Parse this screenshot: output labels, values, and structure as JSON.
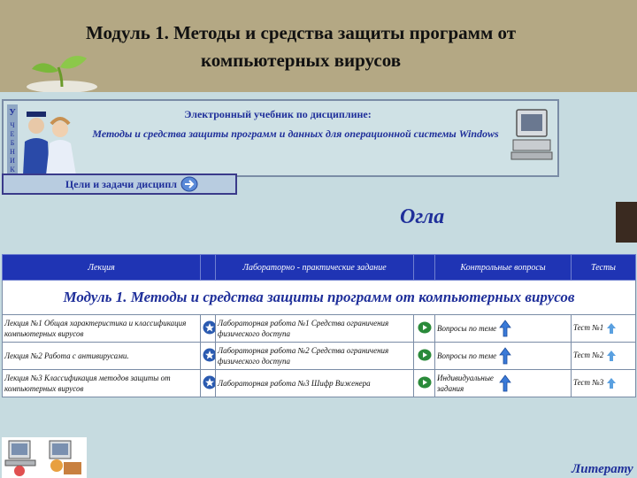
{
  "slide": {
    "title_line1": "Модуль 1. Методы и средства защиты программ от",
    "title_line2": "компьютерных вирусов"
  },
  "header": {
    "line1": "Электронный учебник по дисциплине:",
    "line2": "Методы и средства защиты программ и данных для операционной системы Windows",
    "logo_letters": [
      "У",
      "Ч",
      "Е",
      "Б",
      "Н",
      "И",
      "К"
    ]
  },
  "goals": {
    "label": "Цели и задачи дисципл"
  },
  "ogla": "Огла",
  "table": {
    "headers": [
      "Лекция",
      "Лабораторно - практические задание",
      "Контрольные вопросы",
      "Тесты"
    ],
    "module_title": "Модуль 1. Методы и средства защиты программ от компьютерных вирусов",
    "rows": [
      {
        "lecture": "Лекция №1 Общая характеристика и классификация компьютерных вирусов",
        "lab": "Лабораторная работа №1 Средства ограничения физического доступа",
        "questions": "Вопросы по теме",
        "test": "Тест №1"
      },
      {
        "lecture": "Лекция №2 Работа с антивирусами.",
        "lab": "Лабораторная работа №2 Средства ограничения физического доступа",
        "questions": "Вопросы по теме",
        "test": "Тест №2"
      },
      {
        "lecture": "Лекция №3 Классификация методов защиты от компьютерных вирусов",
        "lab": "Лабораторная работа №3 Шифр Виженера",
        "questions": "Индивидуальные задания",
        "test": "Тест №3"
      }
    ]
  },
  "literature": "Литерату",
  "colors": {
    "title_band": "#b4a884",
    "page_bg": "#c6dbe0",
    "header_row": "#1f34b4",
    "accent_text": "#1f2f9a"
  },
  "icons": [
    "sprout-icon",
    "teachers-icon",
    "computer-icon",
    "forward-button-icon",
    "star-icon",
    "play-icon",
    "up-arrow-icon",
    "pc-users-icon"
  ]
}
